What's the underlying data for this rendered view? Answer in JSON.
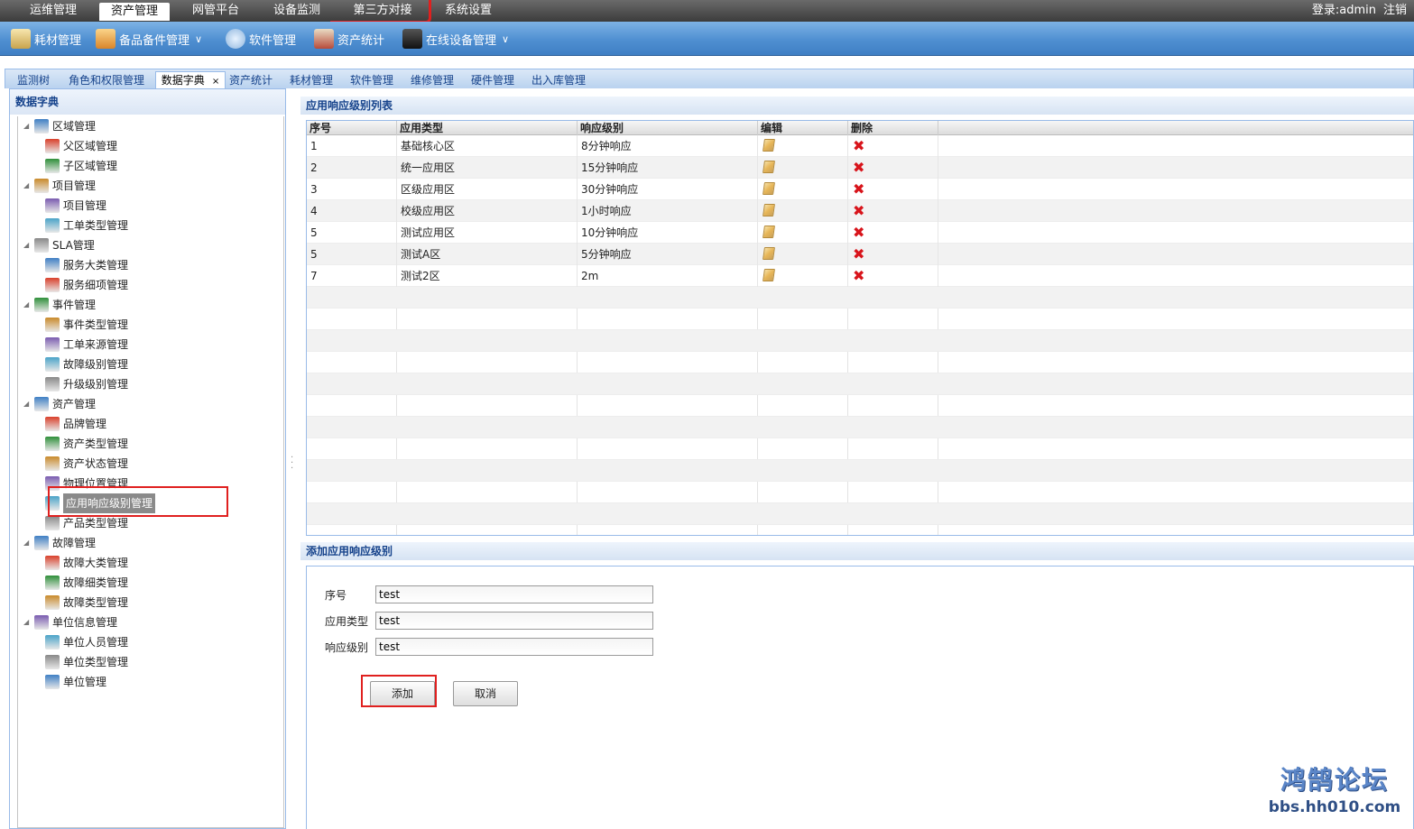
{
  "topbar": {
    "menus": [
      "运维管理",
      "资产管理",
      "网管平台",
      "设备监测",
      "第三方对接",
      "系统设置"
    ],
    "active_menu": "资产管理",
    "login": "登录:admin",
    "logout": "注销"
  },
  "toolbar": {
    "items": [
      "耗材管理",
      "备品备件管理",
      "软件管理",
      "资产统计",
      "在线设备管理"
    ]
  },
  "tabs": {
    "items": [
      "监测树",
      "角色和权限管理",
      "数据字典",
      "资产统计",
      "耗材管理",
      "软件管理",
      "维修管理",
      "硬件管理",
      "出入库管理"
    ],
    "active": "数据字典",
    "close_glyph": "×"
  },
  "leftpanel": {
    "title": "数据字典",
    "tree": [
      {
        "label": "区域管理",
        "level": 0
      },
      {
        "label": "父区域管理",
        "level": 1
      },
      {
        "label": "子区域管理",
        "level": 1
      },
      {
        "label": "项目管理",
        "level": 0
      },
      {
        "label": "项目管理",
        "level": 1
      },
      {
        "label": "工单类型管理",
        "level": 1
      },
      {
        "label": "SLA管理",
        "level": 0
      },
      {
        "label": "服务大类管理",
        "level": 1
      },
      {
        "label": "服务细项管理",
        "level": 1
      },
      {
        "label": "事件管理",
        "level": 0
      },
      {
        "label": "事件类型管理",
        "level": 1
      },
      {
        "label": "工单来源管理",
        "level": 1
      },
      {
        "label": "故障级别管理",
        "level": 1
      },
      {
        "label": "升级级别管理",
        "level": 1
      },
      {
        "label": "资产管理",
        "level": 0
      },
      {
        "label": "品牌管理",
        "level": 1
      },
      {
        "label": "资产类型管理",
        "level": 1
      },
      {
        "label": "资产状态管理",
        "level": 1
      },
      {
        "label": "物理位置管理",
        "level": 1
      },
      {
        "label": "应用响应级别管理",
        "level": 1
      },
      {
        "label": "产品类型管理",
        "level": 1
      },
      {
        "label": "故障管理",
        "level": 0
      },
      {
        "label": "故障大类管理",
        "level": 1
      },
      {
        "label": "故障细类管理",
        "level": 1
      },
      {
        "label": "故障类型管理",
        "level": 1
      },
      {
        "label": "单位信息管理",
        "level": 0
      },
      {
        "label": "单位人员管理",
        "level": 1
      },
      {
        "label": "单位类型管理",
        "level": 1
      },
      {
        "label": "单位管理",
        "level": 1
      }
    ],
    "selected": "应用响应级别管理"
  },
  "grid": {
    "title": "应用响应级别列表",
    "columns": [
      "序号",
      "应用类型",
      "响应级别",
      "编辑",
      "删除"
    ],
    "rows": [
      {
        "no": "1",
        "type": "基础核心区",
        "level": "8分钟响应"
      },
      {
        "no": "2",
        "type": "统一应用区",
        "level": "15分钟响应"
      },
      {
        "no": "3",
        "type": "区级应用区",
        "level": "30分钟响应"
      },
      {
        "no": "4",
        "type": "校级应用区",
        "level": "1小时响应"
      },
      {
        "no": "5",
        "type": "测试应用区",
        "level": "10分钟响应"
      },
      {
        "no": "5",
        "type": "测试A区",
        "level": "5分钟响应"
      },
      {
        "no": "7",
        "type": "测试2区",
        "level": "2m"
      }
    ],
    "edit_icon": "pencil-icon",
    "delete_icon": "red-x-icon",
    "delete_glyph": "✖",
    "delete_color": "#d8141b"
  },
  "form": {
    "title": "添加应用响应级别",
    "fields": [
      {
        "label": "序号",
        "value": "test"
      },
      {
        "label": "应用类型",
        "value": "test"
      },
      {
        "label": "响应级别",
        "value": "test"
      }
    ],
    "add_label": "添加",
    "cancel_label": "取消"
  },
  "watermark": {
    "line1": "鸿鹄论坛",
    "line2": "bbs.hh010.com"
  },
  "colors": {
    "highlight_red": "#e0201f",
    "toolbar_blue": "#4f8fd1",
    "header_text": "#15428b"
  }
}
